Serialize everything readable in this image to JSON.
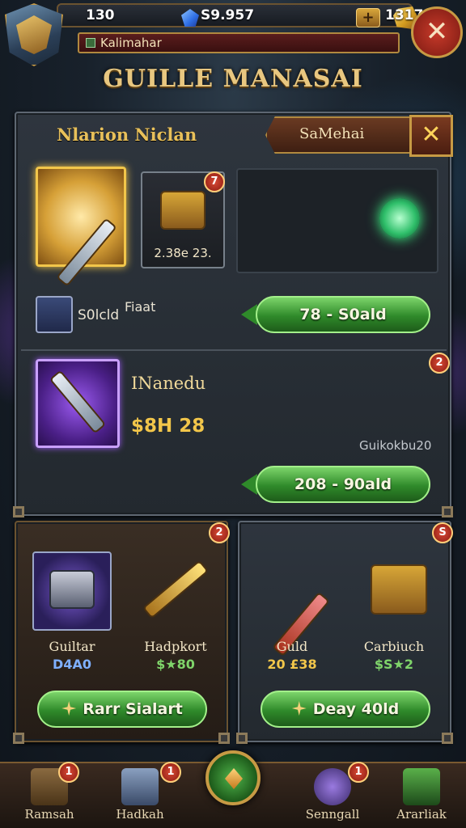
{
  "topbar": {
    "level": "130",
    "gems": "S9.957",
    "gold": "1317",
    "banner": "Kalimahar"
  },
  "title": "GUILLE MANASAI",
  "shop": {
    "section_title": "Nlarion Niclan",
    "tab_label": "SaMehai",
    "featured_item_price": "2.38e 23.",
    "featured_item_badge": "7",
    "row1_label": "S0lcld",
    "row1_feature": "Fiaat",
    "row1_button": "78 - S0ald",
    "item2_name": "INanedu",
    "item2_price": "$8H 28",
    "item2_sub": "Guikokbu20",
    "item2_badge": "2",
    "item2_button": "208 - 90ald"
  },
  "left_panel": {
    "badge": "2",
    "items": [
      {
        "label": "Guiltar",
        "value": "D4A0"
      },
      {
        "label": "Hadpkort",
        "value": "$★80"
      }
    ],
    "button": "Rarr Sialart"
  },
  "right_panel": {
    "badge": "S",
    "items": [
      {
        "label": "Guld",
        "value": "20 £38"
      },
      {
        "label": "Carbiuch",
        "value": "$S★2"
      }
    ],
    "button": "Deay 40ld"
  },
  "nav": {
    "items": [
      {
        "label": "Ramsah",
        "badge": "1"
      },
      {
        "label": "Hadkah",
        "badge": "1"
      },
      {
        "label": "Senngall",
        "badge": "1"
      },
      {
        "label": "Ararliak"
      }
    ]
  },
  "colors": {
    "accent_gold": "#e8c05a",
    "button_green": "#2f8a2a",
    "badge_red": "#d84a36"
  }
}
